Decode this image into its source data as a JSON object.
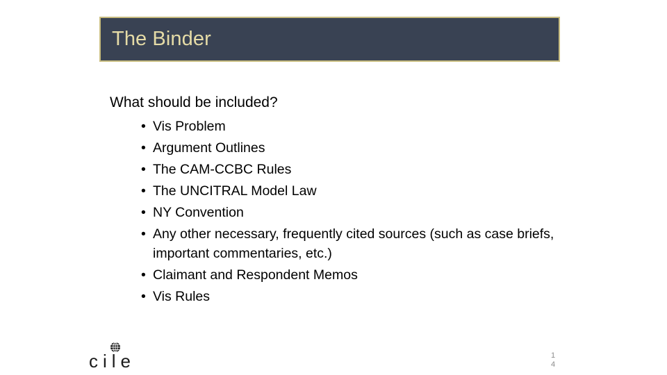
{
  "slide": {
    "background_color": "#FFFFFF",
    "title": {
      "text": "The Binder",
      "text_color": "#E5DBA6",
      "fill_color": "#394253",
      "border_color": "#C8BC7F"
    },
    "lead_line": "What should be included?",
    "bullets": [
      {
        "marker": "•",
        "text": "Vis Problem"
      },
      {
        "marker": "•",
        "text": "Argument Outlines"
      },
      {
        "marker": "•",
        "text": "The CAM-CCBC Rules"
      },
      {
        "marker": "•",
        "text": "The UNCITRAL Model Law"
      },
      {
        "marker": "•",
        "text": "NY Convention"
      },
      {
        "marker": "•",
        "text": "Any other necessary, frequently cited sources (such as case briefs, important commentaries, etc.)"
      },
      {
        "marker": "•",
        "text": "Claimant and Respondent Memos"
      },
      {
        "marker": "•",
        "text": "Vis Rules"
      }
    ],
    "logo": {
      "wordmark": "cile",
      "icon_name": "globe-icon",
      "color": "#1B1B1B"
    },
    "page_number": {
      "digit_top": "1",
      "digit_bottom": "4",
      "color": "#8C8C8C"
    }
  }
}
